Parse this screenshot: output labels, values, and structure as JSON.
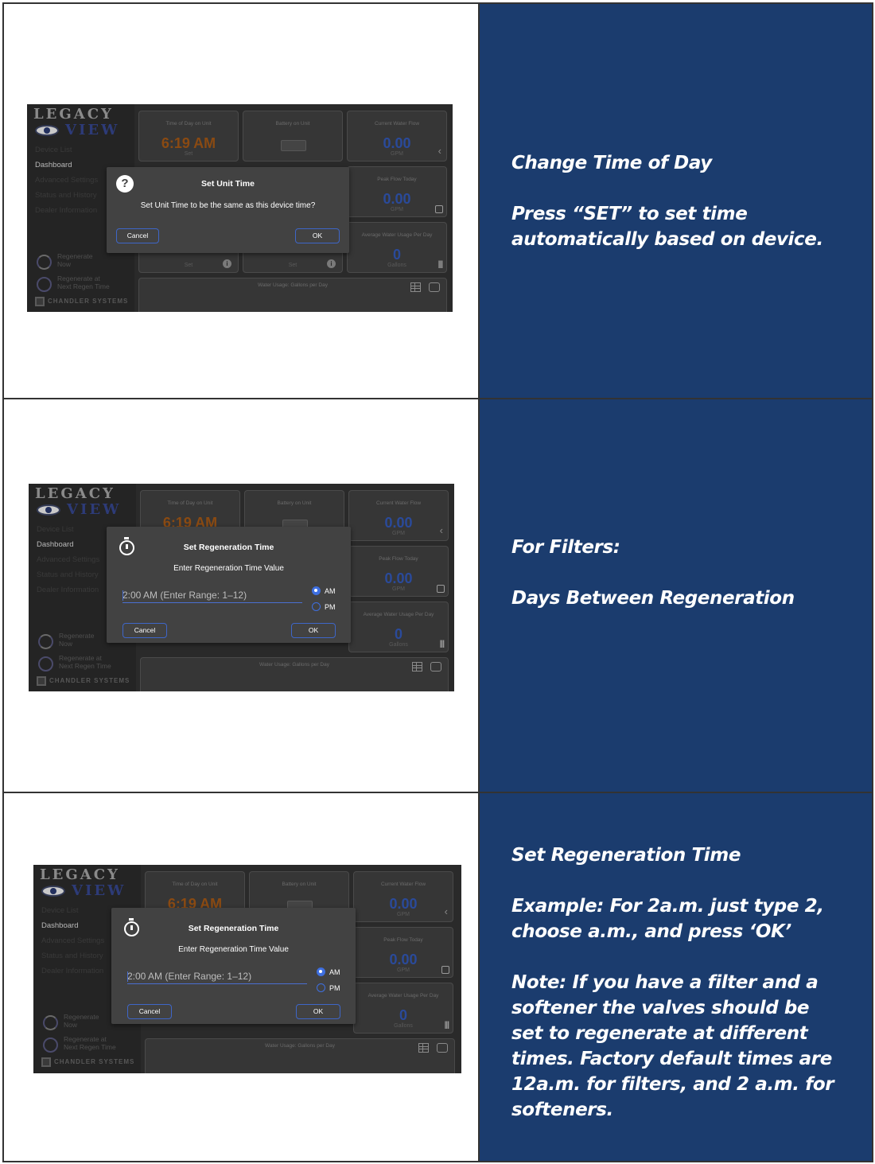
{
  "rows": [
    {
      "screenshot": {
        "logo_top": "LEGACY",
        "logo_bottom": "VIEW",
        "menu": [
          "Device List",
          "Dashboard",
          "Advanced Settings",
          "Status and History",
          "Dealer Information"
        ],
        "active_menu": "Dashboard",
        "regen_now": "Regenerate\nNow",
        "regen_next": "Regenerate at\nNext Regen Time",
        "brand": "Chandler Systems",
        "tiles": {
          "time_title": "Time of Day on Unit",
          "time_value": "6:19 AM",
          "time_sub": "Set",
          "battery_title": "Battery on Unit",
          "flow_title": "Current Water Flow",
          "flow_value": "0.00",
          "flow_sub": "GPM",
          "peak_title": "Peak Flow Today",
          "peak_value": "0.00",
          "peak_sub": "GPM",
          "avg_title": "Average Water Usage Per Day",
          "avg_value": "0",
          "avg_sub": "Gallons",
          "set_a": "Set",
          "set_b": "Set",
          "chart_title": "Water Usage: Gallons per Day"
        },
        "dialog": {
          "title": "Set Unit Time",
          "message": "Set Unit Time to be the same as this device time?",
          "cancel": "Cancel",
          "ok": "OK"
        }
      },
      "notes": [
        "Change Time of Day",
        "Press “SET” to set time automatically based on device."
      ]
    },
    {
      "screenshot": {
        "logo_top": "LEGACY",
        "logo_bottom": "VIEW",
        "menu": [
          "Device List",
          "Dashboard",
          "Advanced Settings",
          "Status and History",
          "Dealer Information"
        ],
        "regen_now": "Regenerate\nNow",
        "regen_next": "Regenerate at\nNext Regen Time",
        "brand": "Chandler Systems",
        "tiles": {
          "time_title": "Time of Day on Unit",
          "time_value": "6:19 AM",
          "battery_title": "Battery on Unit",
          "flow_title": "Current Water Flow",
          "flow_value": "0.00",
          "flow_sub": "GPM",
          "peak_title": "Peak Flow Today",
          "peak_value": "0.00",
          "peak_sub": "GPM",
          "avg_title": "Average Water Usage Per Day",
          "avg_value": "0",
          "avg_sub": "Gallons",
          "chart_title": "Water Usage: Gallons per Day"
        },
        "dialog": {
          "title": "Set Regeneration Time",
          "message": "Enter Regeneration Time Value",
          "input_placeholder": "2:00 AM (Enter Range: 1–12)",
          "am": "AM",
          "pm": "PM",
          "cancel": "Cancel",
          "ok": "OK"
        }
      },
      "notes": [
        "For Filters:",
        "Days Between Regeneration"
      ]
    },
    {
      "screenshot": {
        "logo_top": "LEGACY",
        "logo_bottom": "VIEW",
        "menu": [
          "Device List",
          "Dashboard",
          "Advanced Settings",
          "Status and History",
          "Dealer Information"
        ],
        "regen_now": "Regenerate\nNow",
        "regen_next": "Regenerate at\nNext Regen Time",
        "brand": "Chandler Systems",
        "tiles": {
          "time_title": "Time of Day on Unit",
          "time_value": "6:19 AM",
          "battery_title": "Battery on Unit",
          "flow_title": "Current Water Flow",
          "flow_value": "0.00",
          "flow_sub": "GPM",
          "peak_title": "Peak Flow Today",
          "peak_value": "0.00",
          "peak_sub": "GPM",
          "avg_title": "Average Water Usage Per Day",
          "avg_value": "0",
          "avg_sub": "Gallons",
          "chart_title": "Water Usage: Gallons per Day"
        },
        "dialog": {
          "title": "Set Regeneration Time",
          "message": "Enter Regeneration Time Value",
          "input_placeholder": "2:00 AM (Enter Range: 1–12)",
          "am": "AM",
          "pm": "PM",
          "cancel": "Cancel",
          "ok": "OK"
        }
      },
      "notes": [
        "Set Regeneration Time",
        "Example: For 2a.m.  just type 2, choose a.m., and press ‘OK’",
        "Note: If you have a filter and a softener the valves should be set to regenerate at different times. Factory default times are 12a.m. for filters, and 2 a.m. for softeners."
      ]
    }
  ],
  "colors": {
    "panel_blue": "#1b3c6e",
    "accent_blue": "#3e66c8",
    "time_orange": "#8a4a12"
  },
  "icons": [
    "help-question-icon",
    "stopwatch-icon",
    "chevron-left-icon",
    "table-icon",
    "print-icon",
    "info-icon",
    "bars-icon"
  ]
}
